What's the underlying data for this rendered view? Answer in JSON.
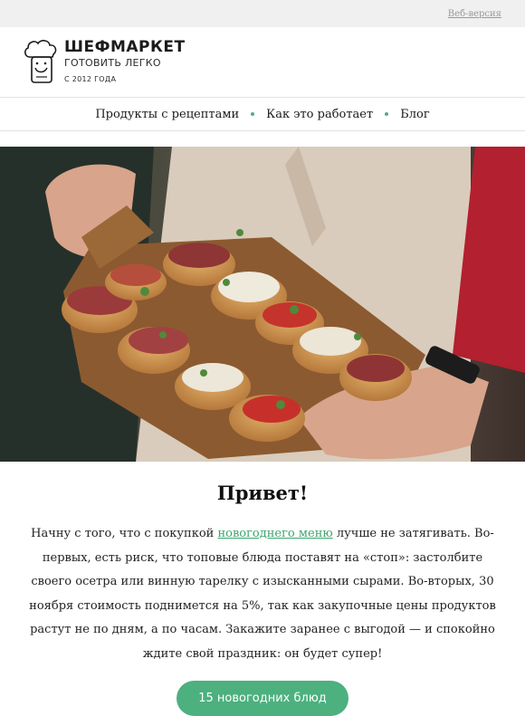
{
  "topbar": {
    "web_version": "Веб-версия"
  },
  "brand": {
    "name": "ШЕФМАРКЕТ",
    "tagline": "ГОТОВИТЬ ЛЕГКО",
    "since": "С 2012 ГОДА",
    "logo_icon": "chef-hat-icon"
  },
  "nav": {
    "items": [
      {
        "label": "Продукты с рецептами"
      },
      {
        "label": "Как это работает"
      },
      {
        "label": "Блог"
      }
    ],
    "separator_color": "#4caf7d"
  },
  "hero": {
    "image": "bruschetta-board-photo"
  },
  "content": {
    "greeting": "Привет!",
    "paragraph_before_link": "Начну с того, что с покупкой ",
    "link_text": "новогоднего меню",
    "paragraph_after_link": " лучше не затягивать. Во-первых, есть риск, что топовые блюда поставят на «стоп»: застолбите своего осетра или винную тарелку с изысканными сырами. Во-вторых, 30 ноября стоимость поднимется на 5%, так как закупочные цены продуктов растут не по дням, а по часам. Закажите заранее с выгодой — и спокойно ждите свой праздник: он будет супер!",
    "cta_label": "15 новогодних блюд"
  },
  "colors": {
    "accent": "#4cb07f",
    "link": "#3da66f",
    "topbar_bg": "#f0f0f0"
  }
}
